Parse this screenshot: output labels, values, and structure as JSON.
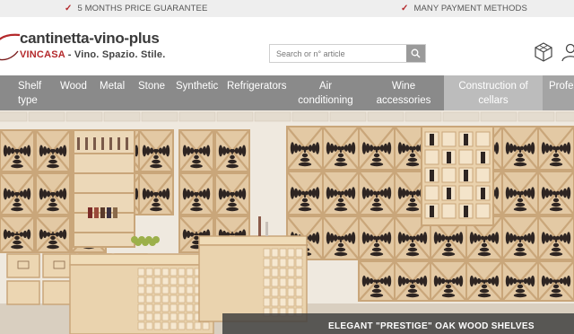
{
  "topbar": {
    "items": [
      {
        "icon": "check-icon",
        "label": "5 MONTHS PRICE GUARANTEE"
      },
      {
        "icon": "check-icon",
        "label": "MANY PAYMENT METHODS"
      }
    ]
  },
  "header": {
    "logo_name": "cantinetta-vino-plus",
    "logo_brand": "VINCASA",
    "logo_tagline": " - Vino. Spazio. Stile.",
    "search_placeholder": "Search or n° article",
    "icons": [
      "search-icon",
      "cube-icon",
      "user-icon"
    ]
  },
  "nav": {
    "items": [
      {
        "label": "Shelf\ntype"
      },
      {
        "label": "Wood"
      },
      {
        "label": "Metal"
      },
      {
        "label": "Stone"
      },
      {
        "label": "Synthetic"
      },
      {
        "label": "Refrigerators"
      },
      {
        "label": "Air\nconditioning"
      },
      {
        "label": "Wine\naccessories"
      },
      {
        "label": "Construction of\ncellars",
        "active": true
      },
      {
        "label": "Profes"
      }
    ]
  },
  "hero": {
    "caption": "ELEGANT \"PRESTIGE\" OAK WOOD SHELVES"
  },
  "colors": {
    "accent": "#b4292b",
    "nav_bg": "#8a8a8a",
    "nav_active": "#bcbcbc",
    "topbar_bg": "#eeeeee"
  }
}
